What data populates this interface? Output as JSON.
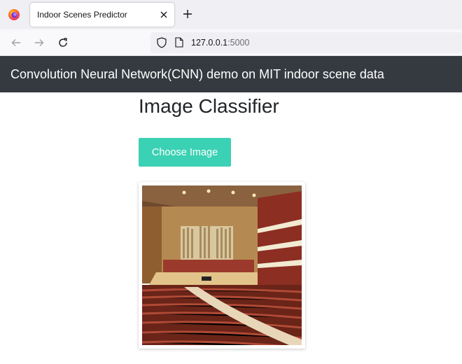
{
  "browser": {
    "tab": {
      "title": "Indoor Scenes Predictor"
    },
    "url": {
      "host": "127.0.0.1",
      "port": ":5000"
    }
  },
  "header": {
    "title": "Convolution Neural Network(CNN) demo on MIT indoor scene data",
    "background": "#343a40"
  },
  "main": {
    "title": "Image Classifier",
    "choose_button": {
      "label": "Choose Image",
      "color": "#3bd1b4"
    },
    "preview": {
      "subject": "concert hall interior with stage, pipe organ and rows of red seats"
    }
  },
  "icons": {
    "browser_logo": "firefox-logo-icon",
    "tab_close": "close-icon",
    "new_tab": "plus-icon",
    "back": "arrow-left-icon",
    "forward": "arrow-right-icon",
    "reload": "reload-icon",
    "shield": "shield-icon",
    "page": "page-icon"
  }
}
